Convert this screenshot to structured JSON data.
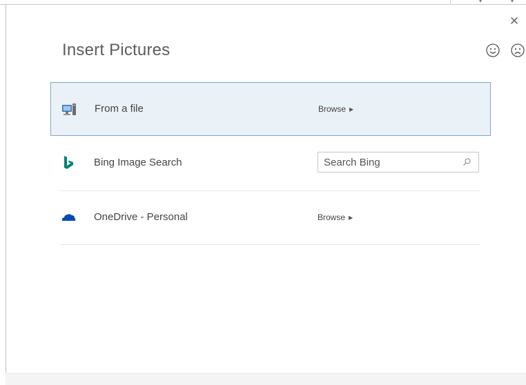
{
  "dialog": {
    "title": "Insert Pictures",
    "close_glyph": "✕",
    "feedback": {
      "smile_icon": "smiley-face-icon",
      "frown_icon": "frowny-face-icon"
    }
  },
  "sources": [
    {
      "label": "From a file",
      "icon": "computer-icon",
      "action": "Browse",
      "selected": true
    },
    {
      "label": "Bing Image Search",
      "icon": "bing-logo-icon",
      "search_placeholder": "Search Bing",
      "search_value": ""
    },
    {
      "label": "OneDrive - Personal",
      "icon": "onedrive-cloud-icon",
      "action": "Browse"
    }
  ],
  "colors": {
    "selected_bg": "#eaf1f7",
    "selected_border": "#7fa7c6",
    "bing": "#008373",
    "onedrive": "#094ab2"
  }
}
